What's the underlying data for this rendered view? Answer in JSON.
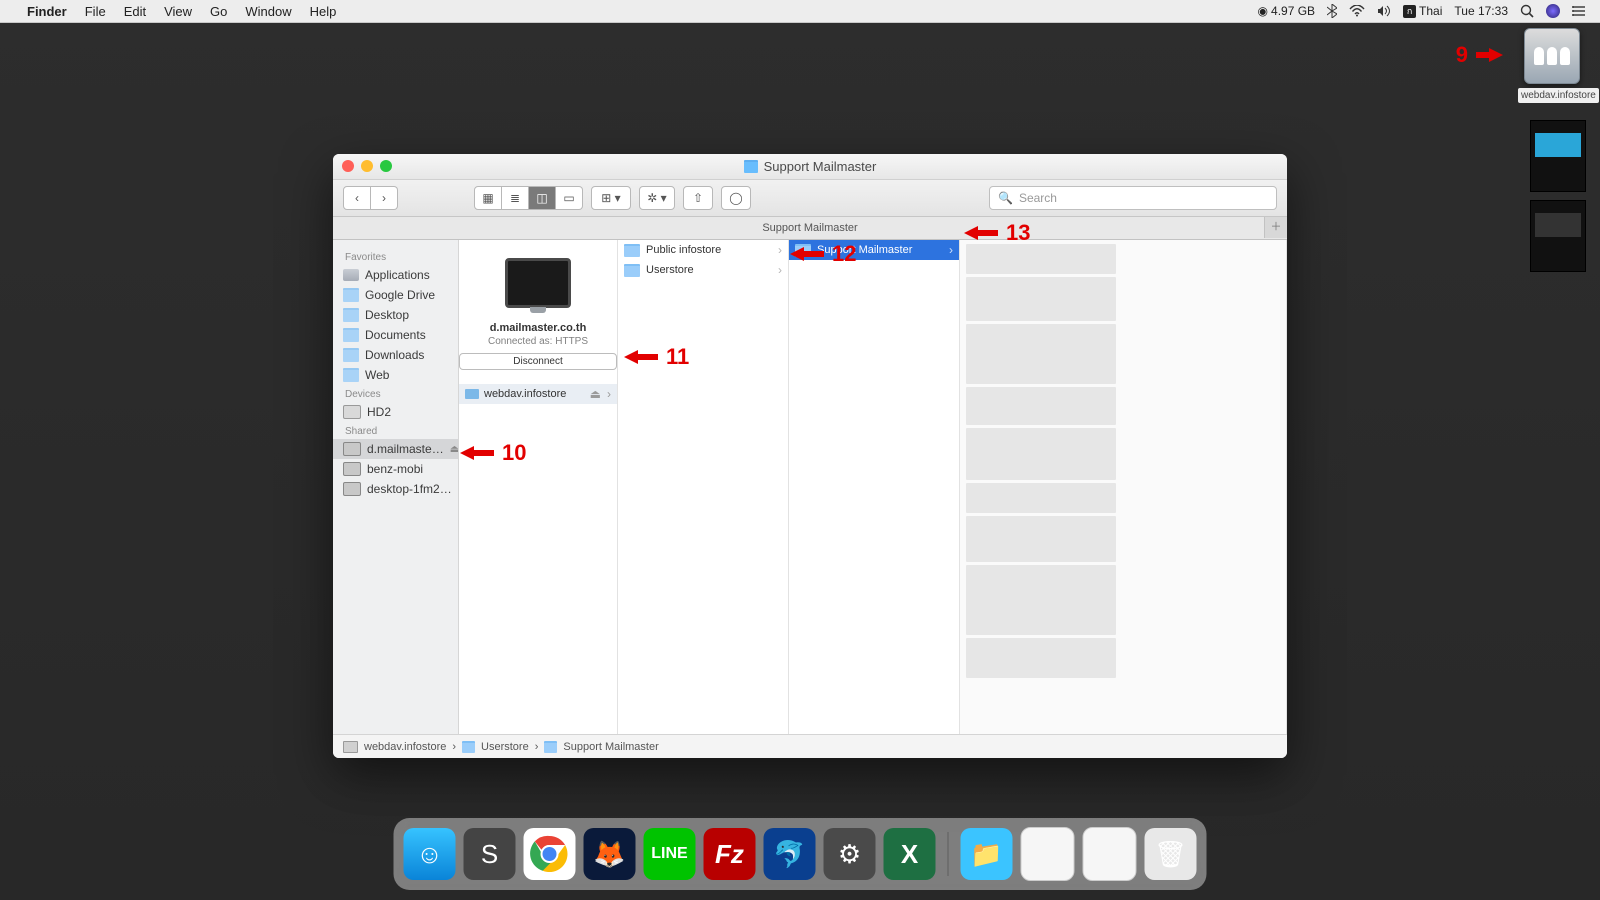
{
  "menubar": {
    "app": "Finder",
    "items": [
      "File",
      "Edit",
      "View",
      "Go",
      "Window",
      "Help"
    ],
    "right": {
      "disk": "4.97 GB",
      "input_src": "Thai",
      "clock": "Tue 17:33"
    }
  },
  "desktop": {
    "net_drive_label": "webdav.infostore"
  },
  "annotations": {
    "a9": "9",
    "a10": "10",
    "a11": "11",
    "a12": "12",
    "a13": "13"
  },
  "finder": {
    "title": "Support Mailmaster",
    "tab": "Support Mailmaster",
    "search_placeholder": "Search",
    "sidebar": {
      "sections": [
        {
          "title": "Favorites",
          "items": [
            {
              "label": "Applications",
              "icon": "app"
            },
            {
              "label": "Google Drive",
              "icon": "fold"
            },
            {
              "label": "Desktop",
              "icon": "fold"
            },
            {
              "label": "Documents",
              "icon": "fold"
            },
            {
              "label": "Downloads",
              "icon": "fold"
            },
            {
              "label": "Web",
              "icon": "fold"
            }
          ]
        },
        {
          "title": "Devices",
          "items": [
            {
              "label": "HD2",
              "icon": "disk"
            }
          ]
        },
        {
          "title": "Shared",
          "items": [
            {
              "label": "d.mailmaste…",
              "icon": "mon",
              "eject": true,
              "sel": true
            },
            {
              "label": "benz-mobi",
              "icon": "mon"
            },
            {
              "label": "desktop-1fm2…",
              "icon": "mon"
            }
          ]
        }
      ]
    },
    "col0": {
      "server": "d.mailmaster.co.th",
      "status": "Connected as: HTTPS",
      "disconnect": "Disconnect",
      "drive": "webdav.infostore"
    },
    "col1": [
      {
        "label": "Public infostore"
      },
      {
        "label": "Userstore"
      }
    ],
    "col2": [
      {
        "label": "Support Mailmaster",
        "sel": true
      }
    ],
    "path": [
      "webdav.infostore",
      "Userstore",
      "Support Mailmaster"
    ]
  },
  "dock": [
    "Finder",
    "Sublime Text",
    "Google Chrome",
    "Firefox",
    "LINE",
    "FileZilla",
    "Sequel Pro",
    "System Preferences",
    "Excel",
    "Downloads",
    "Window 1",
    "Window 2",
    "Trash"
  ]
}
